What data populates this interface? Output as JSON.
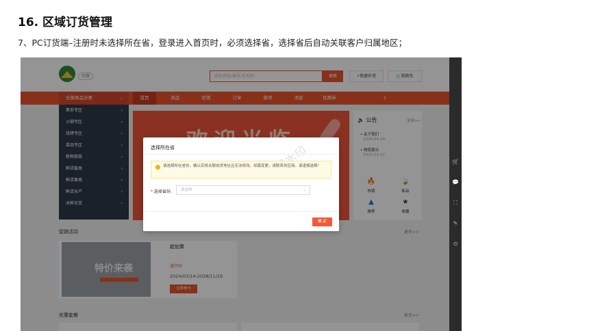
{
  "doc": {
    "heading": "16. 区域订货管理",
    "line": "7、PC订货端–注册时未选择所在省，登录进入首页时，必须选择省，选择省后自动关联客户归属地区；"
  },
  "site": {
    "logo_tag": "切换",
    "search_placeholder": "商品名称/编号/条形码",
    "search_button": "搜索",
    "quick_restock": "快速补货",
    "cart": "购物车"
  },
  "nav": {
    "all_categories": "全部商品分类",
    "items": [
      "首页",
      "商品",
      "促销",
      "订单",
      "款项",
      "消息",
      "优惠券"
    ],
    "right_text": "1"
  },
  "categories": [
    "素系专区",
    "火锅专区",
    "烧烤专区",
    "菜品专区",
    "新鲜蔬菜",
    "鲜活畜类",
    "鲜活禽类",
    "鲜活水产",
    "冰鲜冻货"
  ],
  "banner": {
    "text": "欢迎光临"
  },
  "notice": {
    "title": "公告",
    "more": "全部>>",
    "items": [
      {
        "title": "关于我们",
        "date": "2024-04-19"
      },
      {
        "title": "物流提示",
        "date": "2022-11-17"
      }
    ],
    "quick": [
      {
        "label": "热销",
        "icon": "flame-icon"
      },
      {
        "label": "新品",
        "icon": "leaf-icon"
      },
      {
        "label": "推荐",
        "icon": "mountain-icon"
      },
      {
        "label": "收藏",
        "icon": "star-icon"
      }
    ]
  },
  "promo": {
    "title": "促销活动",
    "more": "更多>>",
    "card": {
      "image_text": "特价来袭",
      "name": "超划算",
      "status": "进行中",
      "date": "2024/03/14-2028/11/16",
      "button": "立即参与"
    }
  },
  "combo": {
    "title": "优惠套餐",
    "more": "更多>>"
  },
  "modal": {
    "title": "选择所在省",
    "warning": "请选择所在省份，确认后将关联收货地址且无法修改。如需变更，请联系供应商。请谨慎选择！",
    "field_label": "选择省份:",
    "field_required": "*",
    "select_placeholder": "请选择",
    "ok": "确 定",
    "watermark": "试用水印"
  },
  "colors": {
    "brand": "#e8532e",
    "nav_dark": "#2d3a4a",
    "warning_bg": "#fffbe6"
  }
}
